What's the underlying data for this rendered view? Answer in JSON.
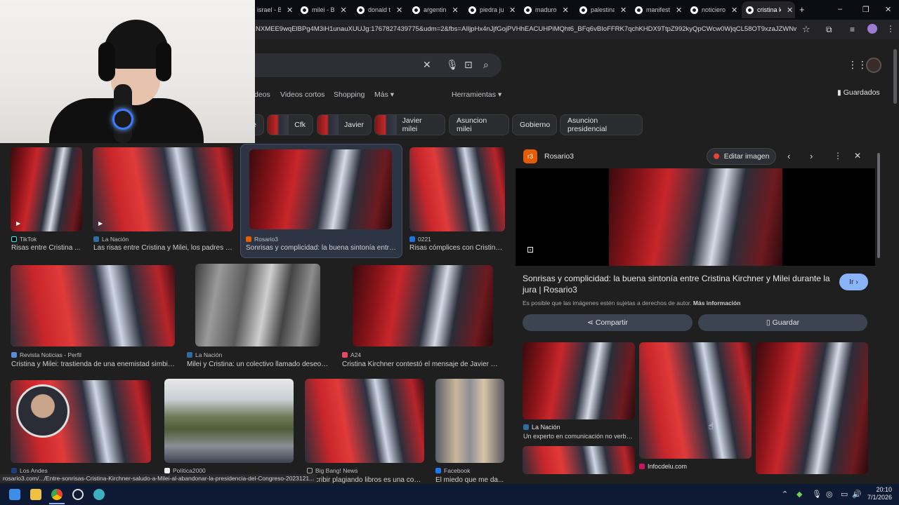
{
  "tabs": [
    {
      "label": "israel - B",
      "active": false
    },
    {
      "label": "milei - B",
      "active": false
    },
    {
      "label": "donald t",
      "active": false
    },
    {
      "label": "argentin",
      "active": false
    },
    {
      "label": "piedra ju",
      "active": false
    },
    {
      "label": "maduro",
      "active": false
    },
    {
      "label": "palestina",
      "active": false
    },
    {
      "label": "manifest",
      "active": false
    },
    {
      "label": "noticiero",
      "active": false
    },
    {
      "label": "cristina k",
      "active": true
    }
  ],
  "new_tab": "+",
  "window": {
    "minimize": "–",
    "restore": "❐",
    "close": "✕"
  },
  "address": {
    "url": "NXMEE9wqElBPg4M3iH1unauXUUJg:1767827439775&udm=2&fbs=AIljpHx4nJjfGojPVHhEACUHPiMQht6_BFq6vBIoFFRK7qchKHDX9TtpZ992kyQpCWcw0WjqCL58OT9xzaJZWNwg8Tb-Q..."
  },
  "nav": {
    "videos": "deos",
    "videos_cortos": "Videos cortos",
    "shopping": "Shopping",
    "mas": "Más",
    "herramientas": "Herramientas",
    "guardados": "Guardados"
  },
  "chips": [
    {
      "label": "e"
    },
    {
      "label": "Cfk"
    },
    {
      "label": "Javier"
    },
    {
      "label": "Javier milei"
    },
    {
      "label": "Asuncion milei"
    },
    {
      "label": "Gobierno"
    },
    {
      "label": "Asuncion presidencial"
    }
  ],
  "results": [
    {
      "source": "TikTok",
      "title": "Risas entre Cristina ..."
    },
    {
      "source": "La Nación",
      "title": "Las risas entre Cristina y Milei, los padres d..."
    },
    {
      "source": "Rosario3",
      "title": "Sonrisas y complicidad: la buena sintonía entre ..."
    },
    {
      "source": "0221",
      "title": "Risas cómplices con Cristina..."
    },
    {
      "source": "Revista Noticias - Perfil",
      "title": "Cristina y Milei: trastienda de una enemistad simbió..."
    },
    {
      "source": "La Nación",
      "title": "Milei y Cristina: un colectivo llamado deseo -..."
    },
    {
      "source": "A24",
      "title": "Cristina Kirchner contestó el mensaje de Javier Mil..."
    },
    {
      "source": "Los Andes",
      "title": ""
    },
    {
      "source": "Política2000",
      "title": ""
    },
    {
      "source": "Big Bang! News",
      "title": "Escribir plagiando libros es una cos..."
    },
    {
      "source": "Facebook",
      "title": "El miedo que me da..."
    }
  ],
  "panel": {
    "source": "Rosario3",
    "edit_button": "Editar imagen",
    "title": "Sonrisas y complicidad: la buena sintonía entre Cristina Kirchner y Milei durante la jura | Rosario3",
    "go_button": "Ir",
    "copyright_note": "Es posible que las imágenes estén sujetas a derechos de autor.",
    "more_info": "Más información",
    "share_button": "Compartir",
    "save_button": "Guardar",
    "related": [
      {
        "source": "La Nación",
        "title": "Un experto en comunicación no verbal..."
      },
      {
        "source": "Infocdelu.com",
        "title": ""
      }
    ]
  },
  "status_bar": "rosario3.com/.../Entre-sonrisas-Cristina-Kirchner-saludo-a-Milei-al-abandonar-la-presidencia-del-Congreso-2023121...",
  "clock": {
    "time": "20:10",
    "date": "7/1/2026"
  },
  "icons": [
    "search-icon",
    "mic-icon",
    "lens-icon",
    "clear-icon",
    "apps-icon",
    "bookmark-icon",
    "star-icon",
    "extension-icon"
  ]
}
